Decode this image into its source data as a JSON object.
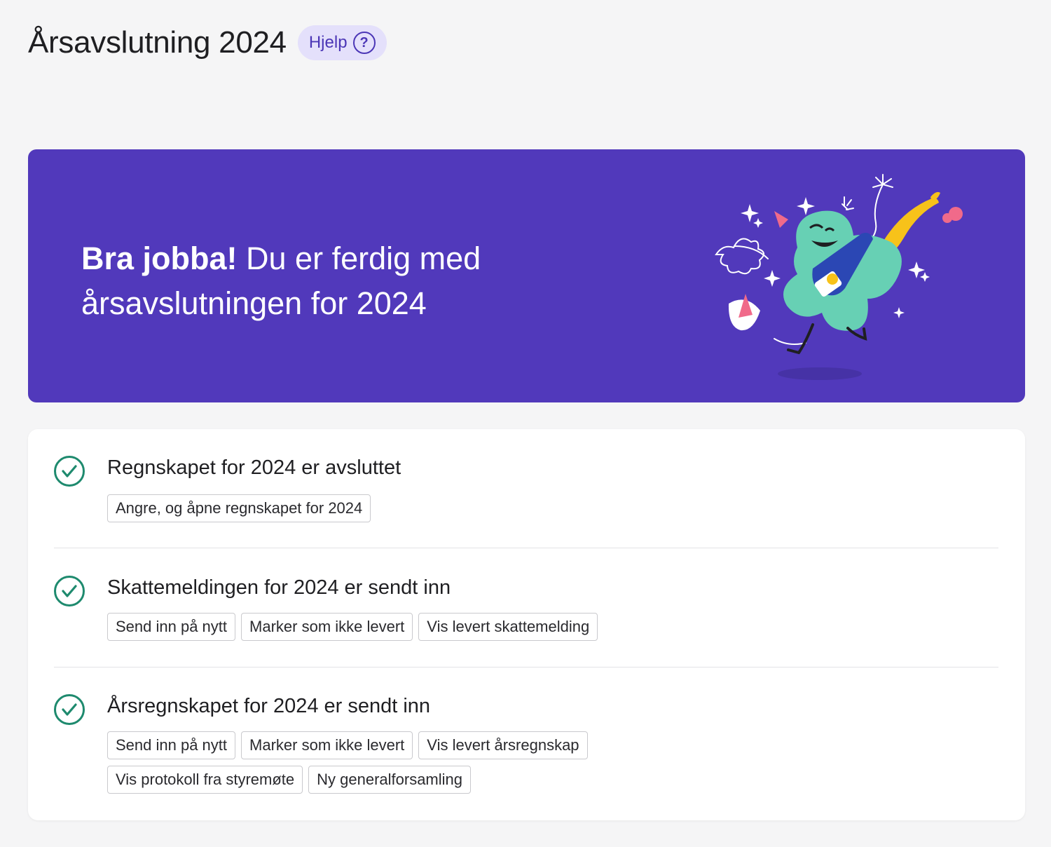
{
  "header": {
    "title": "Årsavslutning 2024",
    "help_label": "Hjelp",
    "help_icon": "?"
  },
  "banner": {
    "title_bold": "Bra jobba!",
    "title_rest": " Du er ferdig med årsavslutningen for 2024",
    "background": "#5139bb",
    "illustration": "celebrating-character-with-champagne"
  },
  "status": {
    "items": [
      {
        "title": "Regnskapet for 2024 er avsluttet",
        "buttons": [
          "Angre, og åpne regnskapet for 2024"
        ]
      },
      {
        "title": "Skattemeldingen for 2024 er sendt inn",
        "buttons": [
          "Send inn på nytt",
          "Marker som ikke levert",
          "Vis levert skattemelding"
        ]
      },
      {
        "title": "Årsregnskapet for 2024 er sendt inn",
        "buttons": [
          "Send inn på nytt",
          "Marker som ikke levert",
          "Vis levert årsregnskap"
        ],
        "buttons_row2": [
          "Vis protokoll fra styremøte",
          "Ny generalforsamling"
        ]
      }
    ],
    "check_color": "#1e8a6e"
  }
}
